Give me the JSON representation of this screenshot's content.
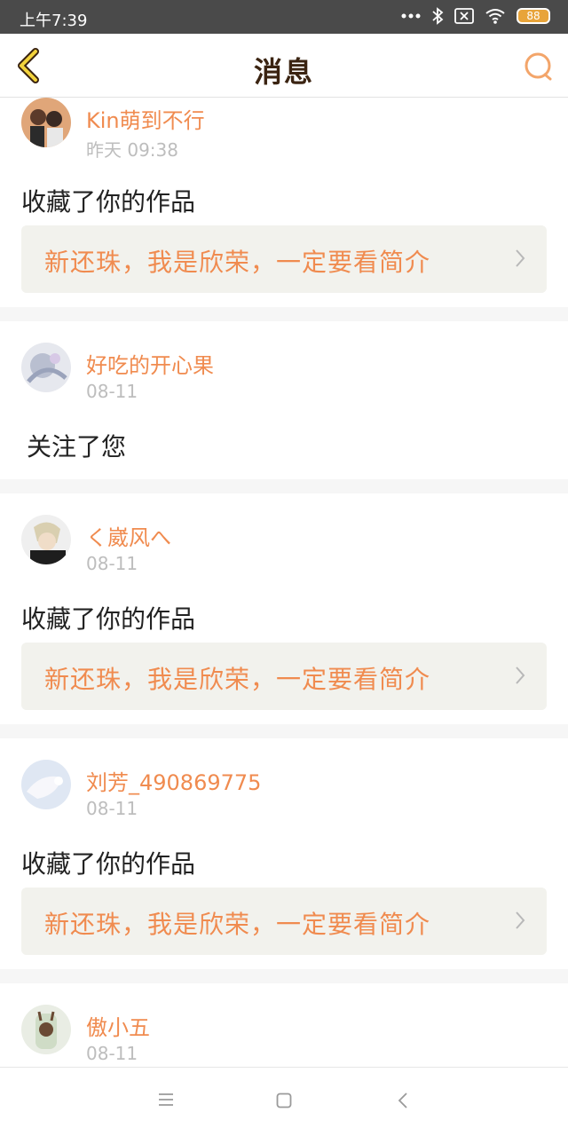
{
  "status_bar": {
    "time": "上午7:39",
    "battery": "88"
  },
  "header": {
    "title": "消息"
  },
  "colors": {
    "accent": "#f08b4f",
    "title": "#3b2412",
    "link_bg": "#f2f2ed"
  },
  "icons": {
    "back": "chevron-left-icon",
    "search": "search-icon",
    "link_arrow": "chevron-right-icon",
    "nav": [
      "menu-icon",
      "home-icon",
      "back-icon"
    ]
  },
  "messages": [
    {
      "user": "Kin萌到不行",
      "time": "昨天 09:38",
      "action": "收藏了你的作品",
      "link": "新还珠，我是欣荣，一定要看简介"
    },
    {
      "user": "好吃的开心果",
      "time": "08-11",
      "action": "关注了您"
    },
    {
      "user": "く崴风へ",
      "time": "08-11",
      "action": "收藏了你的作品",
      "link": "新还珠，我是欣荣，一定要看简介"
    },
    {
      "user": "刘芳_490869775",
      "time": "08-11",
      "action": "收藏了你的作品",
      "link": "新还珠，我是欣荣，一定要看简介"
    },
    {
      "user": "傲小五",
      "time": "08-11"
    }
  ]
}
